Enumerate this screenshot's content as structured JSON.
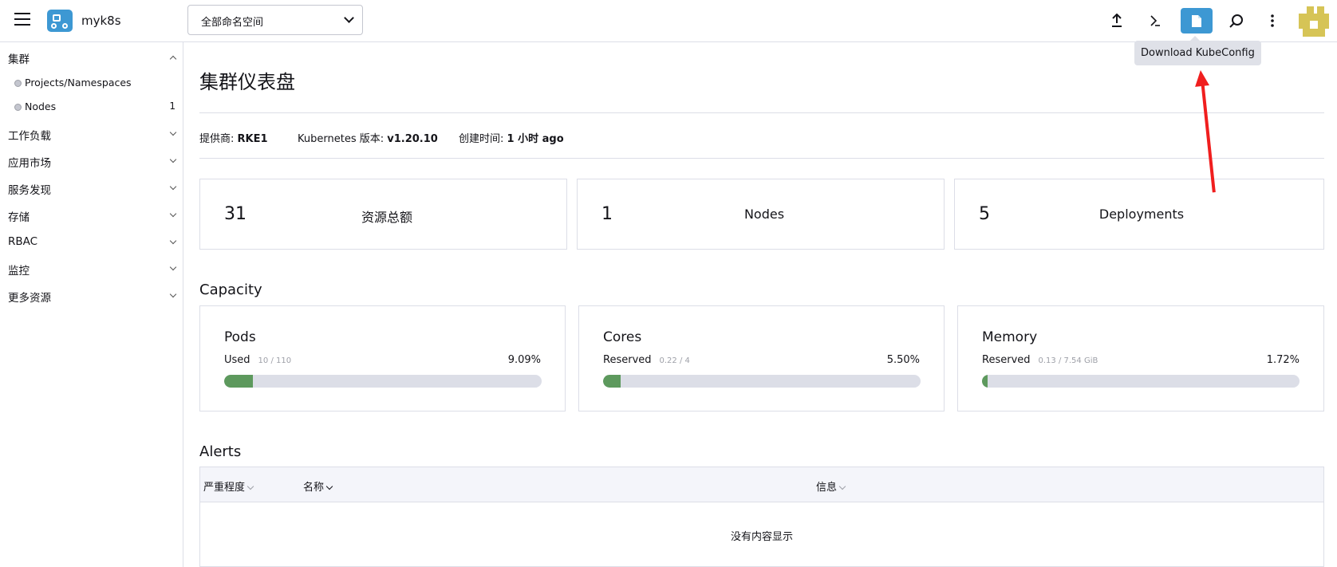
{
  "header": {
    "cluster_name": "myk8s",
    "namespace_select": "全部命名空间",
    "tooltip": "Download KubeConfig",
    "icons": [
      "upload-icon",
      "terminal-icon",
      "file-icon",
      "search-icon",
      "more-vertical-icon"
    ],
    "accent_color": "#3d98d3"
  },
  "sidebar": {
    "cluster_group": "集群",
    "items": [
      {
        "label": "Projects/Namespaces",
        "count": ""
      },
      {
        "label": "Nodes",
        "count": "1"
      }
    ],
    "groups": [
      "工作负载",
      "应用市场",
      "服务发现",
      "存储",
      "RBAC",
      "监控",
      "更多资源"
    ]
  },
  "main": {
    "title": "集群仪表盘",
    "meta": {
      "provider_label": "提供商:",
      "provider_value": "RKE1",
      "version_label": "Kubernetes 版本:",
      "version_value": "v1.20.10",
      "created_label": "创建时间:",
      "created_value": "1 小时 ago"
    },
    "counts": [
      {
        "value": "31",
        "label": "资源总额"
      },
      {
        "value": "1",
        "label": "Nodes"
      },
      {
        "value": "5",
        "label": "Deployments"
      }
    ],
    "capacity_title": "Capacity",
    "gauges": [
      {
        "title": "Pods",
        "sub": "Used",
        "detail": "10 / 110",
        "pct": "9.09%",
        "fraction": 0.0909
      },
      {
        "title": "Cores",
        "sub": "Reserved",
        "detail": "0.22 / 4",
        "pct": "5.50%",
        "fraction": 0.055
      },
      {
        "title": "Memory",
        "sub": "Reserved",
        "detail": "0.13 / 7.54 GiB",
        "pct": "1.72%",
        "fraction": 0.0172
      }
    ],
    "alerts_title": "Alerts",
    "alerts_table": {
      "columns": [
        "严重程度",
        "名称",
        "信息"
      ],
      "empty": "没有内容显示"
    },
    "gauge_color": "#5d995d"
  }
}
